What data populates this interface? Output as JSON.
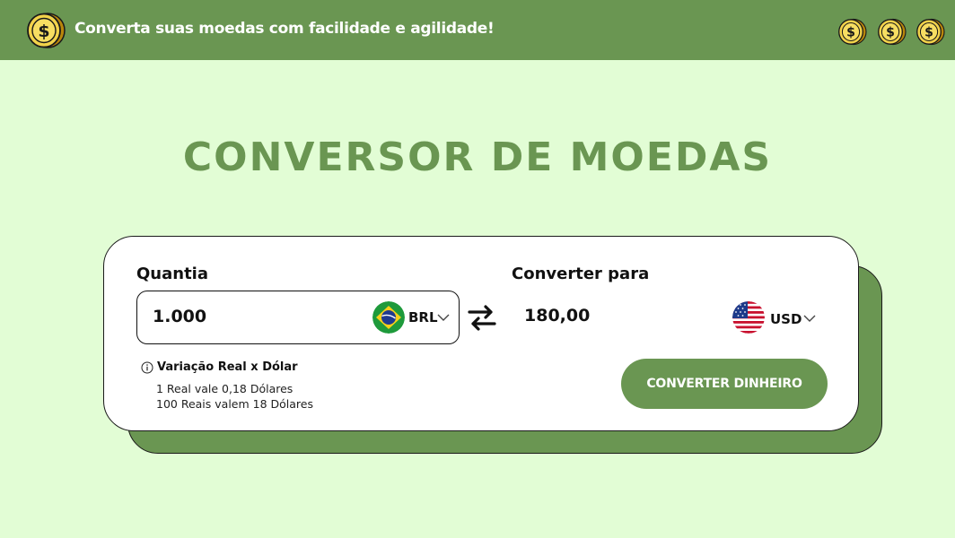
{
  "header": {
    "title": "Converta suas moedas com facilidade e agilidade!",
    "brand_icon": "dollar-coin-icon",
    "coin_icons": [
      "dollar-coin-icon",
      "dollar-coin-icon",
      "dollar-coin-icon"
    ],
    "bg_color": "#6a9652"
  },
  "main": {
    "heading": "CONVERSOR DE MOEDAS",
    "heading_color": "#6a9652",
    "background": "#e2fdd5"
  },
  "converter": {
    "amount_label": "Quantia",
    "amount_value": "1.000",
    "from_currency": {
      "code": "BRL",
      "flag": "brazil-flag-icon"
    },
    "swap_icon": "swap-arrows-icon",
    "target_label": "Converter para",
    "result_value": "180,00",
    "to_currency": {
      "code": "USD",
      "flag": "usa-flag-icon"
    },
    "info": {
      "icon": "info-icon",
      "title": "Variação Real x Dólar",
      "line1": "1 Real vale 0,18 Dólares",
      "line2": "100 Reais valem 18 Dólares"
    },
    "button_label": "CONVERTER DINHEIRO",
    "accent_color": "#6a9652"
  }
}
